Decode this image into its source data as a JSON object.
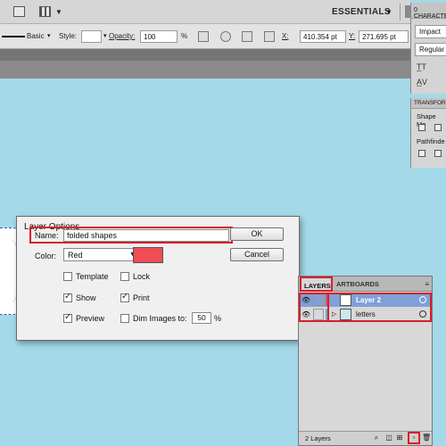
{
  "app_bar": {
    "workspace_label": "ESSENTIALS",
    "icons": [
      "document-icon",
      "arrange-icon",
      "search-icon"
    ]
  },
  "control_bar": {
    "profile_value": "Basic",
    "style_label": "Style:",
    "opacity_label": "Opacity:",
    "opacity_value": "100",
    "opacity_unit": "%",
    "x_label": "X:",
    "x_value": "410.354 pt",
    "y_label": "Y:",
    "y_value": "271.695 pt"
  },
  "character_panel": {
    "tab_label": "0 CHARACTER",
    "font_family": "Impact",
    "font_style": "Regular"
  },
  "transform_panel": {
    "tab_label": "TRANSFORM",
    "shape_modes_label": "Shape Mo",
    "pathfinder_label": "Pathfinde"
  },
  "layer_options_dialog": {
    "title": "Layer Options",
    "name_label": "Name:",
    "name_value": "folded shapes",
    "color_label": "Color:",
    "color_value": "Red",
    "swatch_color": "#ef4c55",
    "ok_label": "OK",
    "cancel_label": "Cancel",
    "options": {
      "template": {
        "label": "Template",
        "checked": false
      },
      "lock": {
        "label": "Lock",
        "checked": false
      },
      "show": {
        "label": "Show",
        "checked": true
      },
      "print": {
        "label": "Print",
        "checked": true
      },
      "preview": {
        "label": "Preview",
        "checked": true
      },
      "dim_images": {
        "label": "Dim Images to:",
        "checked": false
      }
    },
    "dim_value": "50",
    "dim_unit": "%"
  },
  "layers_panel": {
    "tab_layers": "LAYERS",
    "tab_artboards": "ARTBOARDS",
    "layers": [
      {
        "name": "Layer 2",
        "selected": true
      },
      {
        "name": "letters",
        "selected": false
      }
    ],
    "count_label": "2 Layers"
  },
  "colors": {
    "canvas": "#a3d9e8",
    "highlight": "#d6202b",
    "selection": "#7fa1d8"
  }
}
